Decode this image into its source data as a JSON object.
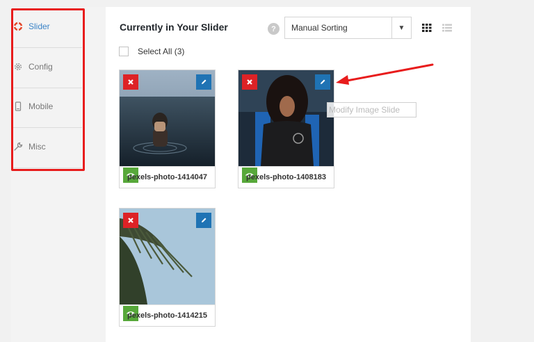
{
  "sidebar": {
    "items": [
      {
        "label": "Slider",
        "icon": "lifebuoy-icon",
        "active": true
      },
      {
        "label": "Config",
        "icon": "gear-icon",
        "active": false
      },
      {
        "label": "Mobile",
        "icon": "mobile-icon",
        "active": false
      },
      {
        "label": "Misc",
        "icon": "wrench-icon",
        "active": false
      }
    ]
  },
  "header": {
    "title": "Currently in Your Slider",
    "help": "?",
    "sort": {
      "value": "Manual Sorting",
      "arrow": "▼"
    }
  },
  "select_all": {
    "label": "Select All (3)"
  },
  "slides": [
    {
      "caption": "pexels-photo-1414047"
    },
    {
      "caption": "pexels-photo-1408183"
    },
    {
      "caption": "pexels-photo-1414215"
    }
  ],
  "tooltip": "Modify Image Slide",
  "colors": {
    "accent": "#3a83c7",
    "delete": "#dd2226",
    "edit": "#1f73b4",
    "view": "#57a83a",
    "annotation": "#e81c1c"
  }
}
